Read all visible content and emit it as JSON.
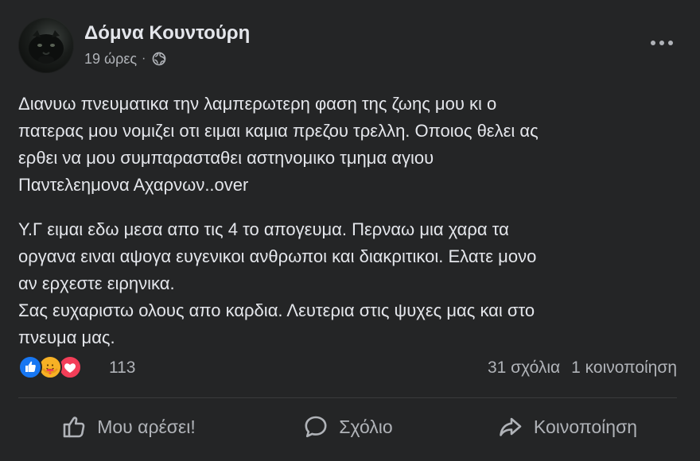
{
  "post": {
    "author": "Δόμνα Κουντούρη",
    "time": "19 ώρες",
    "separator": "·",
    "privacy_icon": "globe-icon",
    "options_icon": "more-options-icon",
    "paragraphs": [
      "Διανυω πνευματικα την λαμπερωτερη φαση της ζωης μου κι ο\nπατερας μου νομιζει οτι ειμαι καμια πρεζου τρελλη. Οποιος θελει ας\nερθει να μου συμπαρασταθει αστηνομικο τμημα αγιου\nΠαντελεημονα Αχαρνων..over",
      "Υ.Γ ειμαι εδω μεσα απο τις 4 το απογευμα. Περναω μια χαρα τα\nοργανα ειναι αψογα ευγενικοι ανθρωποι και διακριτικοι. Ελατε μονο\nαν ερχεστε ειρηνικα.\nΣας ευχαριστω ολους απο καρδια. Λευτερια στις ψυχες μας και στο\nπνευμα μας."
    ]
  },
  "reactions": {
    "types": [
      "like",
      "care",
      "love"
    ],
    "count": "113",
    "comments": "31 σχόλια",
    "shares": "1 κοινοποίηση"
  },
  "actions": {
    "like": "Μου αρέσει!",
    "comment": "Σχόλιο",
    "share": "Κοινοποίηση"
  },
  "colors": {
    "background": "#242526",
    "primary_text": "#e4e6eb",
    "secondary_text": "#b0b3b8",
    "like_blue": "#1877f2",
    "care_yellow": "#f7b125",
    "love_red": "#f33e58"
  }
}
